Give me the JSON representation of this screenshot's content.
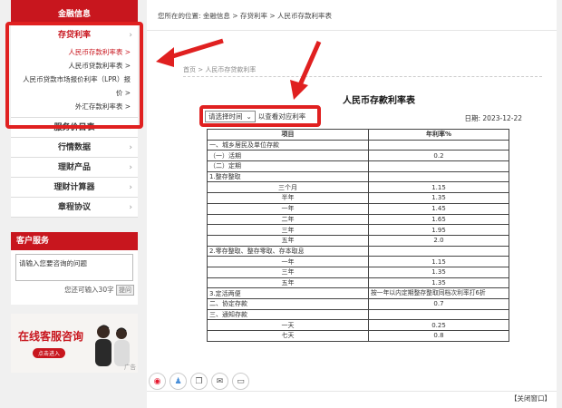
{
  "sidebar": {
    "header": "金融信息",
    "deposit_loan": {
      "title": "存贷利率",
      "items": [
        {
          "label": "人民币存款利率表 >",
          "active": true
        },
        {
          "label": "人民币贷款利率表 >"
        },
        {
          "label": "人民币贷款市场报价利率（LPR）报"
        },
        {
          "label": "价 >"
        },
        {
          "label": "外汇存款利率表 >"
        }
      ]
    },
    "menu": [
      "服务价目表",
      "行情数据",
      "理财产品",
      "理财计算器",
      "章程协议"
    ],
    "customer_service": {
      "title": "客户服务",
      "placeholder": "请输入您要咨询的问题",
      "counter_prefix": "您还可输入30字",
      "submit": "提问"
    },
    "banner": {
      "title": "在线客服咨询",
      "button": "点击进入",
      "ad": "广告"
    }
  },
  "main": {
    "breadcrumb": "您所在的位置: 金融信息 > 存贷利率 > 人民币存款利率表",
    "inner_crumb": "首页 > 人民币存贷款利率",
    "title": "人民币存款利率表",
    "select_value": "请选择时间",
    "select_hint": "以查看对应利率",
    "date_label": "日期:",
    "date_value": "2023-12-22",
    "table": {
      "headers": [
        "项目",
        "年利率%"
      ],
      "rows": [
        {
          "label": "一、城乡居民及单位存款",
          "value": "",
          "align": "left"
        },
        {
          "label": "（一）活期",
          "value": "0.2",
          "align": "left"
        },
        {
          "label": "（二）定期",
          "value": "",
          "align": "left"
        },
        {
          "label": "1.整存整取",
          "value": "",
          "align": "left"
        },
        {
          "label": "三个月",
          "value": "1.15",
          "align": "center"
        },
        {
          "label": "半年",
          "value": "1.35",
          "align": "center"
        },
        {
          "label": "一年",
          "value": "1.45",
          "align": "center"
        },
        {
          "label": "二年",
          "value": "1.65",
          "align": "center"
        },
        {
          "label": "三年",
          "value": "1.95",
          "align": "center"
        },
        {
          "label": "五年",
          "value": "2.0",
          "align": "center"
        },
        {
          "label": "2.零存整取、整存零取、存本取息",
          "value": "",
          "align": "left"
        },
        {
          "label": "一年",
          "value": "1.15",
          "align": "center"
        },
        {
          "label": "三年",
          "value": "1.35",
          "align": "center"
        },
        {
          "label": "五年",
          "value": "1.35",
          "align": "center"
        },
        {
          "label": "3.定活两便",
          "value": "按一年以内定期整存整取同档次利率打6折",
          "align": "left",
          "note": true
        },
        {
          "label": "二、协定存款",
          "value": "0.7",
          "align": "left"
        },
        {
          "label": "三、通知存款",
          "value": "",
          "align": "left"
        },
        {
          "label": "一天",
          "value": "0.25",
          "align": "center"
        },
        {
          "label": "七天",
          "value": "0.8",
          "align": "center"
        }
      ]
    },
    "close": "【关闭窗口】"
  },
  "colors": {
    "brand_red": "#c8161e",
    "annotation_red": "#e02020"
  },
  "icons": [
    "weibo-icon",
    "qq-icon",
    "copy-icon",
    "mail-icon",
    "chat-icon"
  ]
}
